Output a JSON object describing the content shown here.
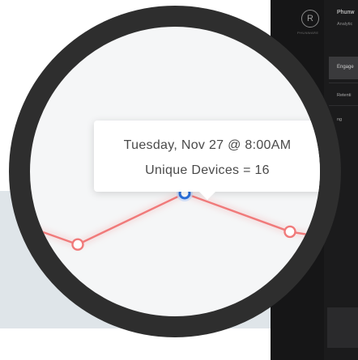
{
  "app": {
    "logo_caption": "PHUNWARE",
    "title": "Phunw",
    "subtitle": "Analytic",
    "nav_active": "Engage",
    "nav_items": [
      "Retenti",
      "ng"
    ]
  },
  "tooltip": {
    "datetime": "Tuesday, Nov 27 @ 8:00AM",
    "metric": "Unique Devices = 16"
  },
  "chart_data": {
    "type": "line",
    "series": [
      {
        "values": [
          14,
          12,
          16,
          13,
          12
        ]
      }
    ],
    "highlighted_index": 2,
    "highlighted_label": "Tuesday, Nov 27 @ 8:00AM",
    "line_color": "#f07a7a",
    "highlight_color": "#2a6fdb"
  }
}
